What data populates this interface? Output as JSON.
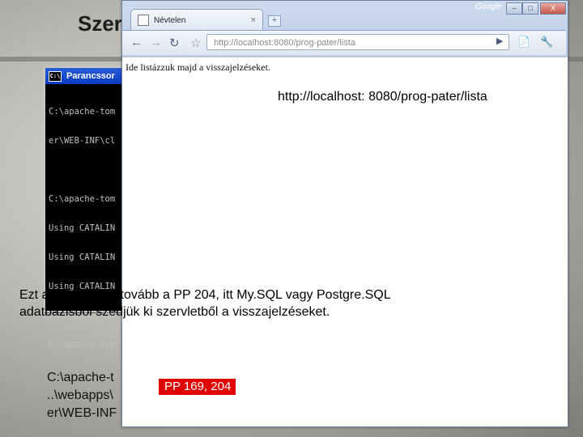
{
  "slide": {
    "title": "Szerv",
    "path_lines": [
      "C:\\apache-t",
      "..\\webapps\\",
      "er\\WEB-INF"
    ]
  },
  "console": {
    "title": "Parancssor",
    "lines": [
      "C:\\apache-tom",
      "er\\WEB-INF\\cl",
      "",
      "C:\\apache-tom",
      "Using CATALIN",
      "Using CATALIN",
      "Using CATALIN",
      "Using JRE_HOM",
      "C:\\apache-tom"
    ]
  },
  "browser": {
    "tab_title": "Névtelen",
    "tab_close": "×",
    "new_tab": "+",
    "brand": "Google",
    "window_buttons": {
      "minimize": "–",
      "maximize": "□",
      "close": "X"
    },
    "nav": {
      "back": "←",
      "forward": "→",
      "reload": "↻",
      "star": "☆",
      "go": "▶",
      "page_menu": "📄",
      "wrench": "🔧"
    },
    "address": "http://localhost:8080/prog-pater/lista",
    "page_text": "Ide listázzuk majd a visszajelzéseket."
  },
  "callouts": {
    "url": "http://localhost: 8080/prog-pater/lista",
    "note": "Ezt a példát viszi tovább a PP 204, itt My.SQL vagy Postgre.SQL adatbázisból szedjük ki szervletből a visszajelzéseket.",
    "ref": "PP 169, 204"
  },
  "colors": {
    "badge": "#e00000",
    "titlebar": "#1d4fd0"
  }
}
